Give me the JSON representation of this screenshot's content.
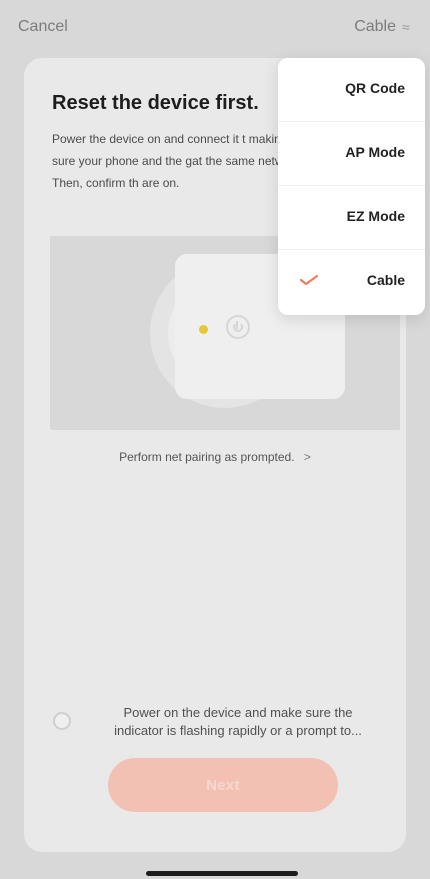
{
  "header": {
    "cancel": "Cancel",
    "current_mode": "Cable"
  },
  "content": {
    "title": "Reset the device first.",
    "description": "Power the device on and connect it t making sure your phone and the gat the same network. Then, confirm th are on.",
    "prompt": "Perform net pairing as prompted.",
    "prompt_chevron": ">",
    "confirm_line1": "Power on the device and make sure the",
    "confirm_line2": "indicator is flashing rapidly or a prompt to...",
    "next_label": "Next"
  },
  "menu": {
    "items": [
      {
        "label": "QR Code",
        "selected": false
      },
      {
        "label": "AP Mode",
        "selected": false
      },
      {
        "label": "EZ Mode",
        "selected": false
      },
      {
        "label": "Cable",
        "selected": true
      }
    ]
  },
  "colors": {
    "accent": "#ee7d5b",
    "menu_bg": "#ffffff",
    "screen_bg": "#d8d8d8",
    "card_bg": "#e9e9e9"
  },
  "icons": {
    "wave": "wave-icon",
    "check": "check-icon",
    "power": "power-icon"
  }
}
